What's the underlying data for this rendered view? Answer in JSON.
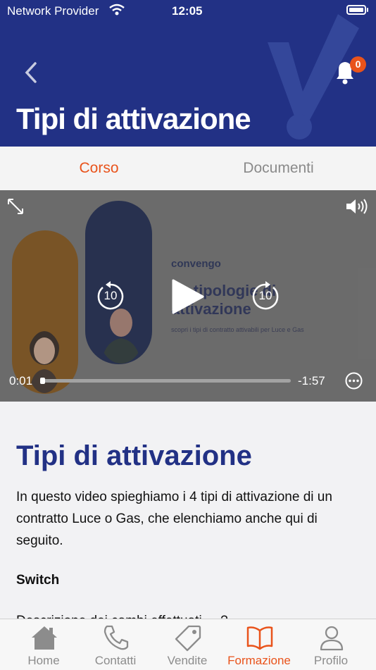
{
  "status_bar": {
    "carrier": "Network Provider",
    "time": "12:05"
  },
  "header": {
    "title": "Tipi di attivazione",
    "notification_count": "0",
    "bg_color": "#223185"
  },
  "tabs": [
    {
      "label": "Corso",
      "active": true
    },
    {
      "label": "Documenti",
      "active": false
    }
  ],
  "video": {
    "brand": "convengo",
    "slide_title_line1": "Le tipologie di",
    "slide_title_line2": "attivazione",
    "slide_subtitle": "scopri i tipi di contratto attivabili per Luce e Gas",
    "elapsed": "0:01",
    "remaining": "-1:57",
    "skip_back_seconds": "10",
    "skip_forward_seconds": "10",
    "progress": 0.01
  },
  "content": {
    "title": "Tipi di attivazione",
    "paragraph": "In questo video spieghiamo i 4 tipi di attivazione di un contratto Luce o Gas, che elenchiamo anche qui di seguito.",
    "subheading": "Switch",
    "partial_text": "Descrizione dei cambi effettuati ... ?"
  },
  "tabbar": [
    {
      "label": "Home",
      "icon": "home-icon",
      "active": false
    },
    {
      "label": "Contatti",
      "icon": "phone-icon",
      "active": false
    },
    {
      "label": "Vendite",
      "icon": "tag-icon",
      "active": false
    },
    {
      "label": "Formazione",
      "icon": "book-icon",
      "active": true
    },
    {
      "label": "Profilo",
      "icon": "person-icon",
      "active": false
    }
  ],
  "colors": {
    "accent": "#e9531b",
    "brand_blue": "#223185"
  }
}
